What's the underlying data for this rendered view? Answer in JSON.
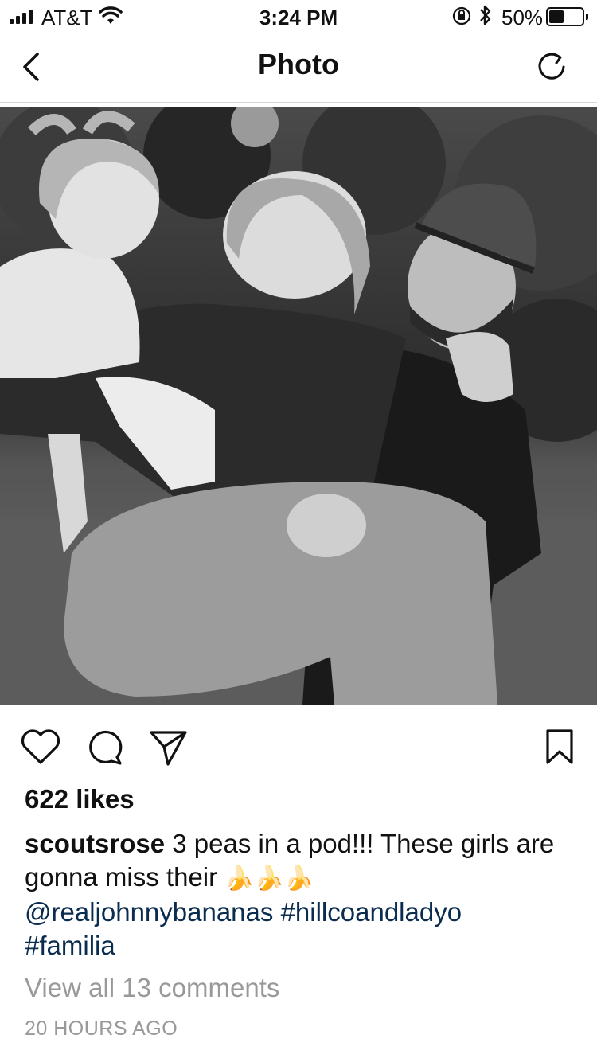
{
  "status_bar": {
    "carrier": "AT&T",
    "time": "3:24 PM",
    "battery_percent": "50%",
    "battery_level": 0.5
  },
  "nav": {
    "title": "Photo",
    "back_icon": "chevron-left-icon",
    "refresh_icon": "refresh-icon"
  },
  "post": {
    "image_alt": "Black and white photo of a man in a cap carrying a smiling woman who holds a toddler, outdoors",
    "likes": "622 likes",
    "username": "scoutsrose",
    "caption_text": " 3 peas in a pod!!! These girls are gonna miss their ",
    "caption_emoji": "🍌🍌🍌",
    "mention": "@realjohnnybananas",
    "hashtag1": "#hillcoandladyo",
    "hashtag2": "#familia",
    "view_comments": "View all 13 comments",
    "timestamp": "20 HOURS AGO"
  },
  "actions": {
    "like_icon": "heart-icon",
    "comment_icon": "comment-icon",
    "share_icon": "send-icon",
    "save_icon": "bookmark-icon"
  }
}
